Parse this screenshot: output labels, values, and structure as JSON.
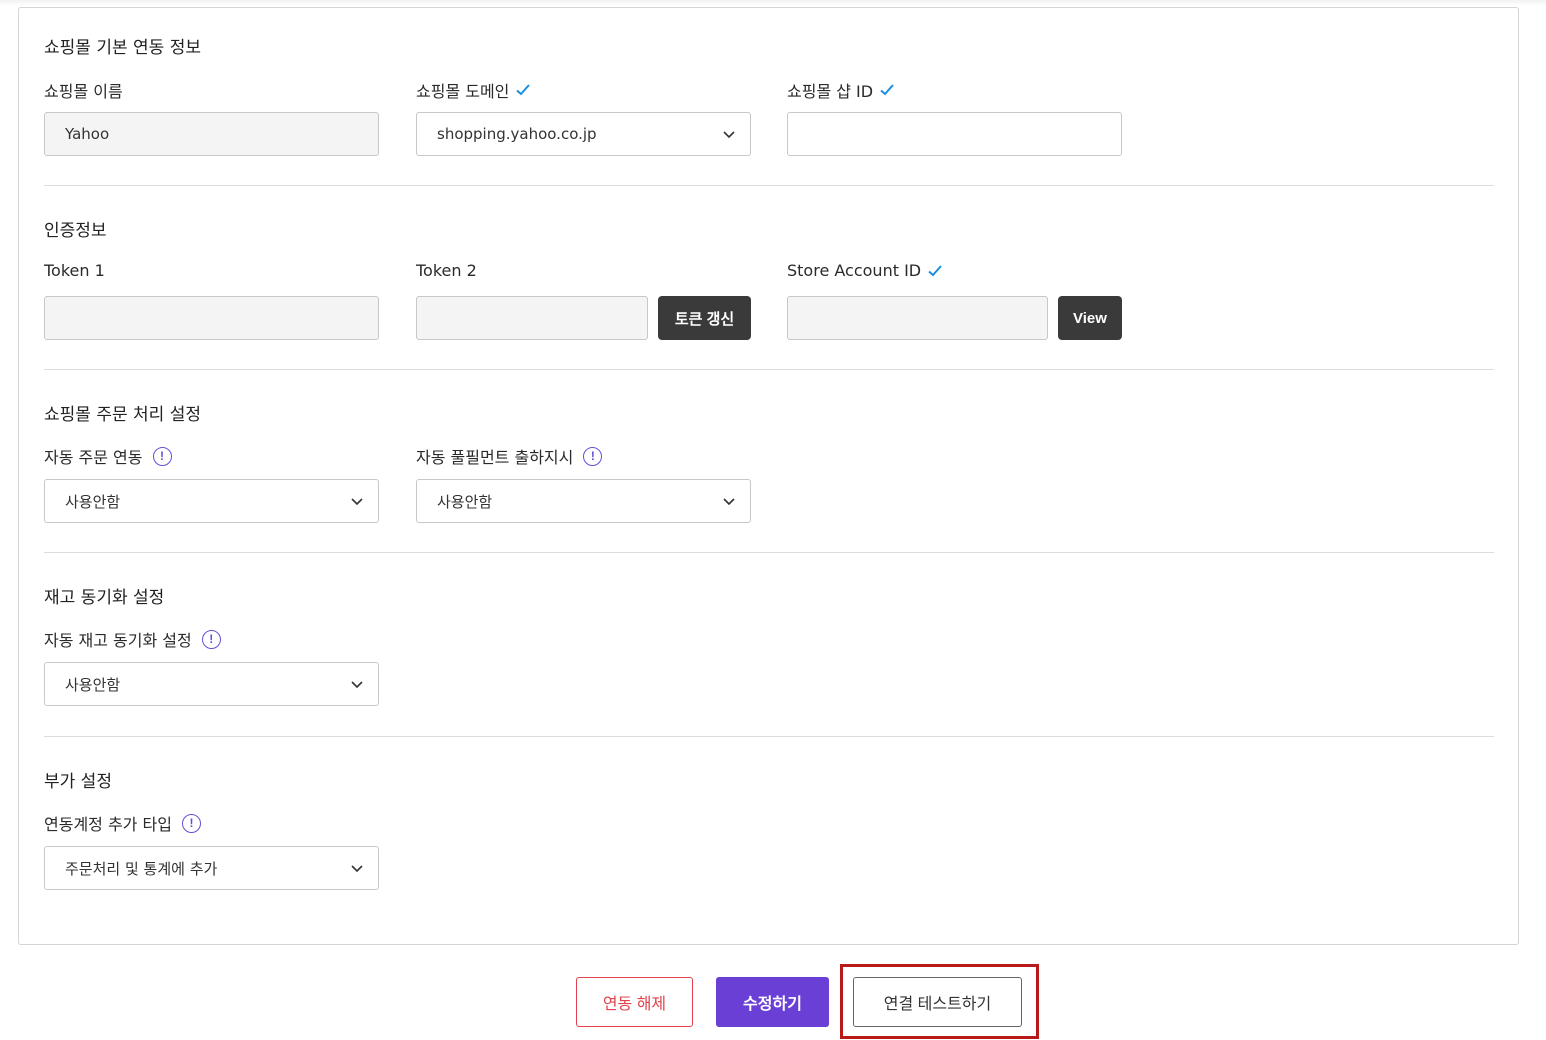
{
  "sections": {
    "basic": {
      "title": "쇼핑몰 기본 연동 정보",
      "mall_name": {
        "label": "쇼핑몰 이름",
        "value": "Yahoo"
      },
      "mall_domain": {
        "label": "쇼핑몰 도메인",
        "value": "shopping.yahoo.co.jp"
      },
      "shop_id": {
        "label": "쇼핑몰 샵 ID",
        "value": ""
      }
    },
    "auth": {
      "title": "인증정보",
      "token1": {
        "label": "Token 1",
        "value": ""
      },
      "token2": {
        "label": "Token 2",
        "value": ""
      },
      "token_refresh_label": "토큰 갱신",
      "store_account": {
        "label": "Store Account ID",
        "value": ""
      },
      "view_label": "View"
    },
    "order": {
      "title": "쇼핑몰 주문 처리 설정",
      "auto_order": {
        "label": "자동 주문 연동",
        "value": "사용안함"
      },
      "auto_fulfillment": {
        "label": "자동 풀필먼트 출하지시",
        "value": "사용안함"
      }
    },
    "stock": {
      "title": "재고 동기화 설정",
      "auto_stock": {
        "label": "자동 재고 동기화 설정",
        "value": "사용안함"
      }
    },
    "extra": {
      "title": "부가 설정",
      "account_type": {
        "label": "연동계정 추가 타입",
        "value": "주문처리 및 통계에 추가"
      }
    }
  },
  "footer": {
    "unlink_label": "연동 해제",
    "edit_label": "수정하기",
    "test_label": "연결 테스트하기"
  },
  "icons": {
    "check": "check-icon",
    "info": "info-icon",
    "chevron": "chevron-down-icon",
    "info_glyph": "!"
  },
  "colors": {
    "accent": "#6a3fd6",
    "danger": "#e0434b",
    "check": "#1a8fe0",
    "highlight": "#b81919"
  }
}
